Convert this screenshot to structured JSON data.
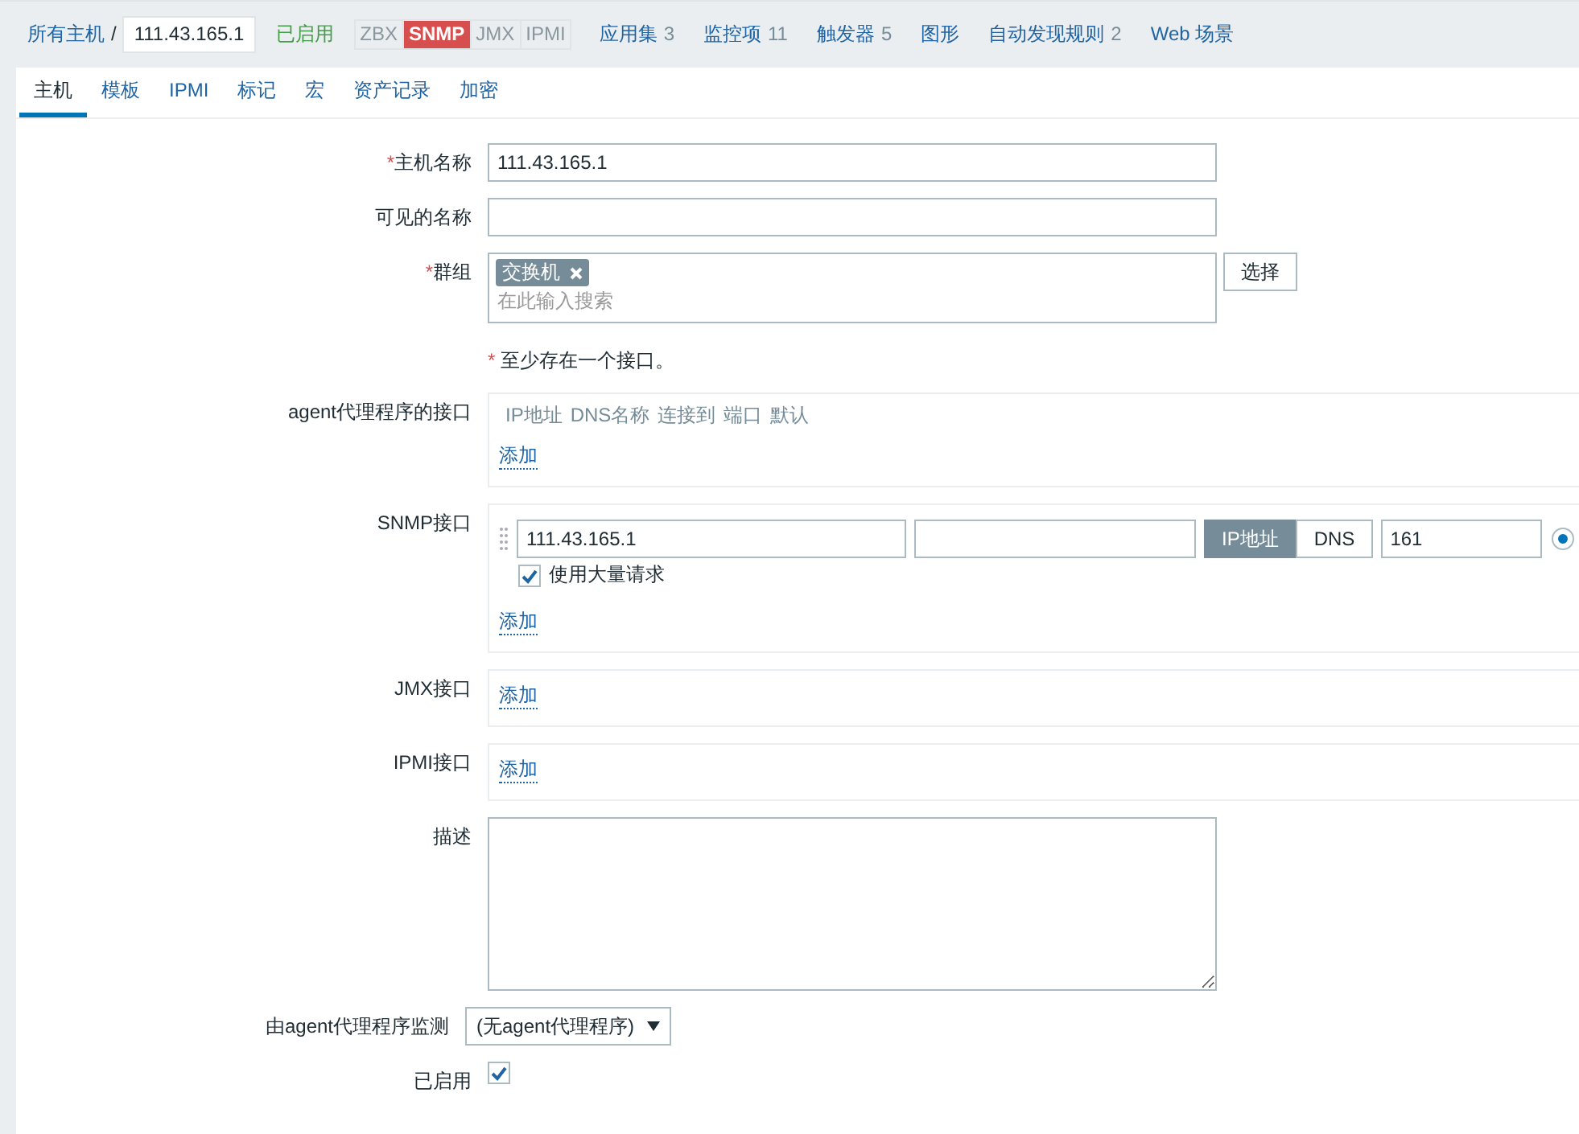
{
  "header": {
    "breadcrumb": "所有主机",
    "separator": "/",
    "host": "111.43.165.1",
    "status": "已启用",
    "availability": [
      {
        "label": "ZBX",
        "error": false
      },
      {
        "label": "SNMP",
        "error": true
      },
      {
        "label": "JMX",
        "error": false
      },
      {
        "label": "IPMI",
        "error": false
      }
    ],
    "links": [
      {
        "label": "应用集",
        "count": "3"
      },
      {
        "label": "监控项",
        "count": "11"
      },
      {
        "label": "触发器",
        "count": "5"
      },
      {
        "label": "图形"
      },
      {
        "label": "自动发现规则",
        "count": "2"
      },
      {
        "label": "Web 场景"
      }
    ]
  },
  "tabs": [
    {
      "label": "主机",
      "selected": true
    },
    {
      "label": "模板",
      "selected": false
    },
    {
      "label": "IPMI",
      "selected": false
    },
    {
      "label": "标记",
      "selected": false
    },
    {
      "label": "宏",
      "selected": false
    },
    {
      "label": "资产记录",
      "selected": false
    },
    {
      "label": "加密",
      "selected": false
    }
  ],
  "fields": [
    {
      "kind": "text",
      "label": "主机名称",
      "required": true,
      "value": "111.43.165.1"
    },
    {
      "kind": "text",
      "label": "可见的名称",
      "required": false
    },
    {
      "kind": "multiselect",
      "label": "群组",
      "required": true,
      "tags": [
        "交换机"
      ],
      "placeholder": "在此输入搜索",
      "button": "选择"
    },
    {
      "kind": "note",
      "mark": "*",
      "text": "至少存在一个接口。"
    },
    {
      "kind": "interfaces",
      "label": "agent代理程序的接口",
      "columns": [
        "IP地址",
        "DNS名称",
        "连接到",
        "端口",
        "默认"
      ],
      "add": "添加"
    },
    {
      "kind": "interfaces",
      "label": "SNMP接口",
      "rows": [
        {
          "ip": "111.43.165.1",
          "connect": [
            {
              "label": "IP地址",
              "selected": true
            },
            {
              "label": "DNS",
              "selected": false
            }
          ],
          "port": "161",
          "default": true,
          "bulk": {
            "label": "使用大量请求",
            "checked": true
          }
        }
      ],
      "add": "添加"
    },
    {
      "kind": "interfaces",
      "label": "JMX接口",
      "add": "添加"
    },
    {
      "kind": "interfaces",
      "label": "IPMI接口",
      "add": "添加"
    },
    {
      "kind": "textarea",
      "label": "描述"
    },
    {
      "kind": "select",
      "label": "由agent代理程序监测",
      "value": "(无agent代理程序)"
    },
    {
      "kind": "checkbox",
      "label": "已启用",
      "checked": true
    }
  ]
}
